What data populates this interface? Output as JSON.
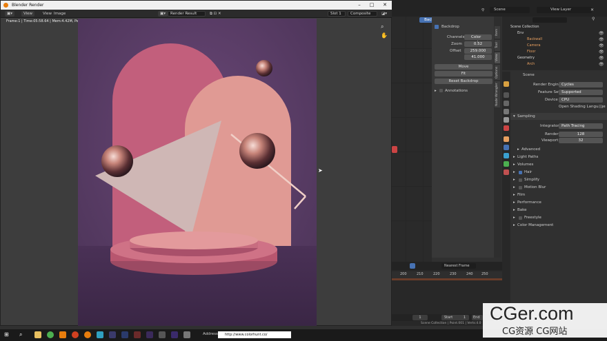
{
  "render_window": {
    "title": "Blender Render",
    "header": {
      "view": "View",
      "image": "Image",
      "result": "Render Result",
      "slot": "Slot 1",
      "composite": "Composite"
    },
    "stats": "Frame:1 | Time:05:58.64 | Mem:4.42M, Peak: 97.33M"
  },
  "node_props": {
    "backdrop_tab": "Backdrop",
    "backdrop": "Backdrop",
    "channels_label": "Channels",
    "channels_value": "Color and...",
    "zoom_label": "Zoom",
    "zoom_value": "0.52",
    "offset_label": "Offset",
    "offset_x": "259.000",
    "offset_y": "41.000",
    "move": "Move",
    "fit": "Fit",
    "reset": "Reset Backdrop",
    "annotations": "Annotations"
  },
  "vtabs": [
    "Item",
    "Tool",
    "View",
    "Options",
    "Node Wrangler"
  ],
  "top": {
    "scene": "Scene",
    "view_layer": "View Layer"
  },
  "outliner": {
    "collection": "Scene Collection",
    "rows": [
      "Env",
      "Backwall",
      "Camera",
      "Floor",
      "Geometry",
      "Arch"
    ]
  },
  "properties": {
    "scene": "Scene",
    "render_engine_label": "Render Engine",
    "render_engine": "Cycles",
    "feature_set_label": "Feature Set",
    "feature_set": "Supported",
    "device_label": "Device",
    "device": "CPU",
    "osl": "Open Shading Language",
    "sampling": "Sampling",
    "integrator_label": "Integrator",
    "integrator": "Path Tracing",
    "render_label": "Render",
    "render": "128",
    "viewport_label": "Viewport",
    "viewport": "32",
    "advanced": "Advanced",
    "sections": [
      "Light Paths",
      "Volumes",
      "Hair",
      "Simplify",
      "Motion Blur",
      "Film",
      "Performance",
      "Bake",
      "Freestyle",
      "Color Management"
    ]
  },
  "timeline": {
    "frame_select": "Nearest Frame",
    "ticks": [
      "200",
      "210",
      "220",
      "230",
      "240",
      "250"
    ],
    "frame": "1",
    "start_label": "Start",
    "start": "1",
    "end_label": "End"
  },
  "statusbar": {
    "collection": "Scene Collection | Point.001 | Verts:4.0"
  },
  "taskbar": {
    "address_label": "Address",
    "address": "http://www.colorhunt.co/"
  },
  "watermark": {
    "brand": "CGer.com",
    "sub": "CG资源 CG网站"
  },
  "colors": {
    "accent": "#4772b3",
    "bg": "#303030",
    "canvas_bg": "#5d3f6c"
  }
}
